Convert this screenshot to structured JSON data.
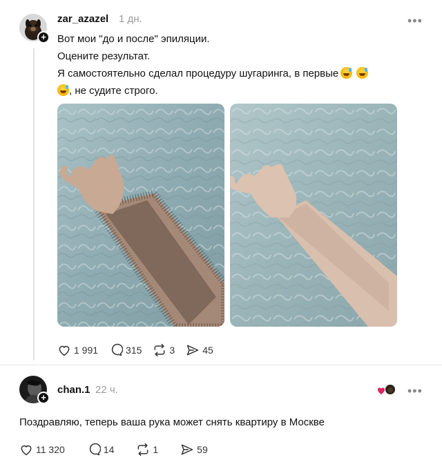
{
  "post": {
    "username": "zar_azazel",
    "time": "1 дн.",
    "more": "•••",
    "text_lines": [
      "Вот мои \"до и после\" эпиляции.",
      "Оцените результат.",
      "Я самостоятельно сделал процедуру шугаринга, в первые",
      ", не судите строго."
    ],
    "photos": [
      "before-photo",
      "after-photo"
    ],
    "likes": "1 991",
    "comments": "315",
    "reposts": "3",
    "shares": "45"
  },
  "reply": {
    "username": "chan.1",
    "time": "22 ч.",
    "more": "•••",
    "text": "Поздравляю, теперь ваша рука может снять квартиру в Москве",
    "likes": "11 320",
    "comments": "14",
    "reposts": "1",
    "shares": "59"
  },
  "colors": {
    "text": "#101010",
    "muted": "#9a9a9a",
    "heart": "#e0245e",
    "divider": "#e6e6e6"
  }
}
